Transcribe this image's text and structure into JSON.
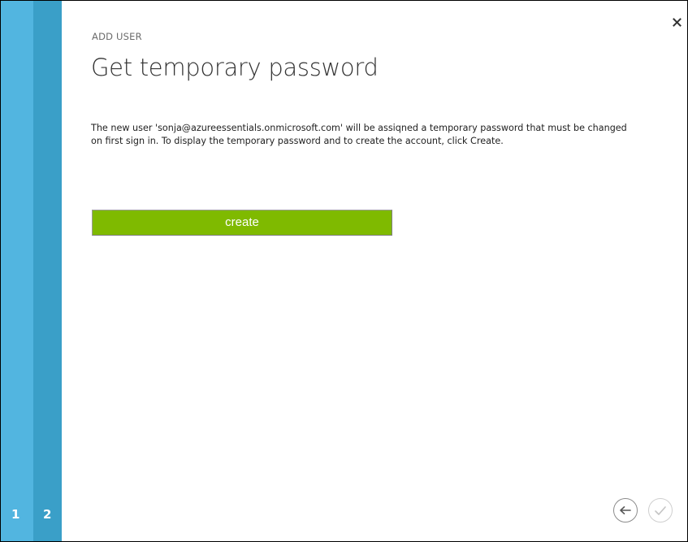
{
  "wizard": {
    "steps": [
      {
        "number": "1",
        "color": "#52b5e0"
      },
      {
        "number": "2",
        "color": "#3a9fc8"
      }
    ],
    "eyebrow": "ADD USER",
    "title": "Get temporary password",
    "description": "The new user 'sonja@azureessentials.onmicrosoft.com' will be assiqned a temporary password that must be changed on first sign in. To display the temporary password and to create the account, click Create.",
    "create_label": "create",
    "close_icon": "close-icon",
    "back_icon": "arrow-left-icon",
    "finish_icon": "checkmark-icon"
  },
  "colors": {
    "accent_green": "#7fba00",
    "step_active": "#3a9fc8",
    "step_done": "#52b5e0"
  }
}
